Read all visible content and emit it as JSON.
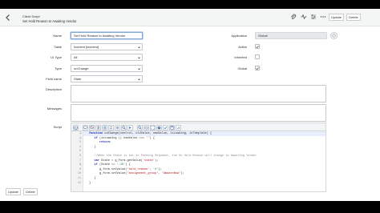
{
  "header": {
    "title": "Client Script",
    "subtitle": "Set Hold Reason to Awaiting Vendor",
    "buttons": {
      "update": "Update",
      "delete": "Delete"
    },
    "icons": [
      "paperclip-icon",
      "activity-icon",
      "settings-icon",
      "more-icon"
    ]
  },
  "form": {
    "name": {
      "label": "Name",
      "value": "Set Hold Reason to Awaiting Vendor"
    },
    "table": {
      "label": "Table",
      "value": "Incident [incident]"
    },
    "ui_type": {
      "label": "UI Type",
      "value": "All"
    },
    "type": {
      "label": "Type",
      "value": "onChange"
    },
    "field_name": {
      "label": "Field name",
      "value": "State"
    },
    "description": {
      "label": "Description",
      "value": ""
    },
    "messages": {
      "label": "Messages",
      "value": ""
    },
    "script_label": "Script",
    "application": {
      "label": "Application",
      "value": "Global"
    },
    "active": {
      "label": "Active",
      "checked": true
    },
    "inherited": {
      "label": "Inherited",
      "checked": false
    },
    "global": {
      "label": "Global",
      "checked": true
    }
  },
  "script": {
    "line_numbers": [
      "1",
      "2",
      "3",
      "4",
      "5",
      "6",
      "7",
      "8",
      "9",
      "10",
      "11",
      "12"
    ],
    "lines": [
      "function onChange(control, oldValue, newValue, isLoading, isTemplate) {",
      "   if (isLoading || newValue === '') {",
      "      return;",
      "   }",
      "",
      "   //When the State is set to Pending Shipment, the On Hold Reason will change to Awaiting Vendor",
      "   var State = g_form.getValue('state');",
      "   if (State == '-10') {",
      "      g_form.setValue('hold_reason', '4');",
      "      g_form.setValue('assignment_group', 'AmazonNow');",
      "   }",
      "}"
    ]
  },
  "footer": {
    "update": "Update",
    "delete": "Delete"
  },
  "colors": {
    "header_bg": "#f4f5f5",
    "page_bg": "#ffffff",
    "letterbox": "#000000",
    "keyword": "#1d2aa8",
    "string": "#b0131e"
  }
}
